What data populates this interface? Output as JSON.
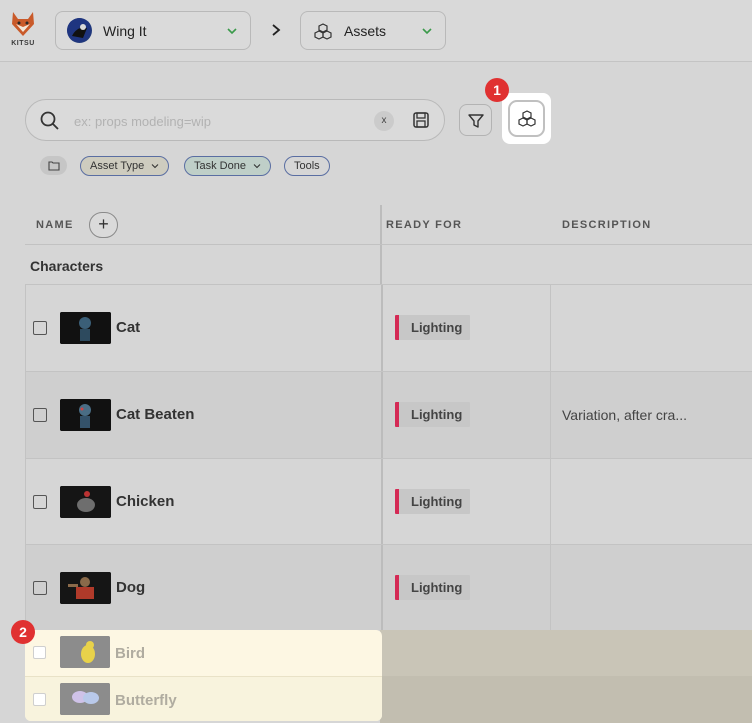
{
  "topbar": {
    "logo_text": "KITSU",
    "production": "Wing It",
    "section": "Assets"
  },
  "search": {
    "placeholder": "ex: props modeling=wip",
    "value": "",
    "clear_label": "x"
  },
  "filters": {
    "chips": [
      "Asset Type",
      "Task Done",
      "Tools"
    ]
  },
  "badges": {
    "first": "1",
    "second": "2"
  },
  "table": {
    "headers": {
      "name": "NAME",
      "ready_for": "READY FOR",
      "description": "DESCRIPTION"
    },
    "add_column_label": "+",
    "group_title": "Characters",
    "rows": [
      {
        "name": "Cat",
        "ready_for": "Lighting",
        "description": ""
      },
      {
        "name": "Cat Beaten",
        "ready_for": "Lighting",
        "description": "Variation, after cra..."
      },
      {
        "name": "Chicken",
        "ready_for": "Lighting",
        "description": ""
      },
      {
        "name": "Dog",
        "ready_for": "Lighting",
        "description": ""
      }
    ],
    "highlighted_rows": [
      {
        "name": "Bird"
      },
      {
        "name": "Butterfly"
      }
    ]
  },
  "colors": {
    "badge": "#e03131",
    "ready_marker": "#d42a55",
    "dropdown_chevron": "#3a9a4a",
    "highlight": "#fdf7e3"
  },
  "icons": [
    "kitsu-fox-logo",
    "chevron-down-icon",
    "chevron-right-icon",
    "search-icon",
    "save-icon",
    "filter-icon",
    "group-assets-icon",
    "folder-icon"
  ]
}
